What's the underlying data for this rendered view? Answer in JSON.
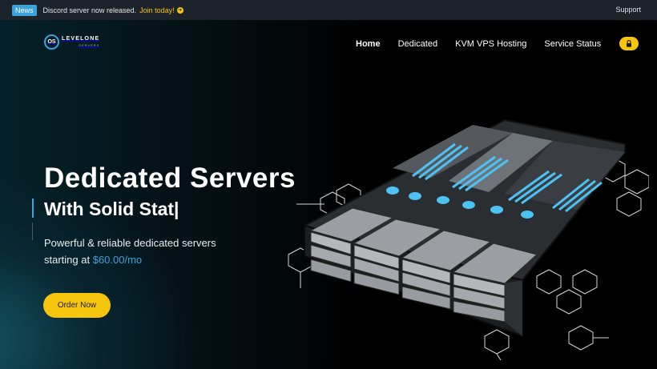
{
  "newsbar": {
    "badge": "News",
    "message": "Discord server now released.",
    "link_label": "Join today!",
    "support_label": "Support"
  },
  "brand": {
    "logo_mark": "OS",
    "name": "LEVELONE",
    "sub": "SERVERS"
  },
  "nav": {
    "items": [
      {
        "label": "Home",
        "active": true
      },
      {
        "label": "Dedicated",
        "active": false
      },
      {
        "label": "KVM VPS Hosting",
        "active": false
      },
      {
        "label": "Service Status",
        "active": false
      }
    ]
  },
  "hero": {
    "title": "Dedicated Servers",
    "subtitle": "With Solid Stat|",
    "desc_line1": "Powerful & reliable dedicated servers",
    "desc_line2_prefix": "starting at",
    "price": "$60.00/mo",
    "cta_label": "Order Now"
  },
  "colors": {
    "accent_yellow": "#f6c60e",
    "accent_blue": "#3aa3dc",
    "newsbar_bg": "#1d232b"
  },
  "icons": {
    "news_arrow": "arrow-right-circle-icon",
    "lock": "lock-icon",
    "hero_image": "server-rack-illustration"
  }
}
